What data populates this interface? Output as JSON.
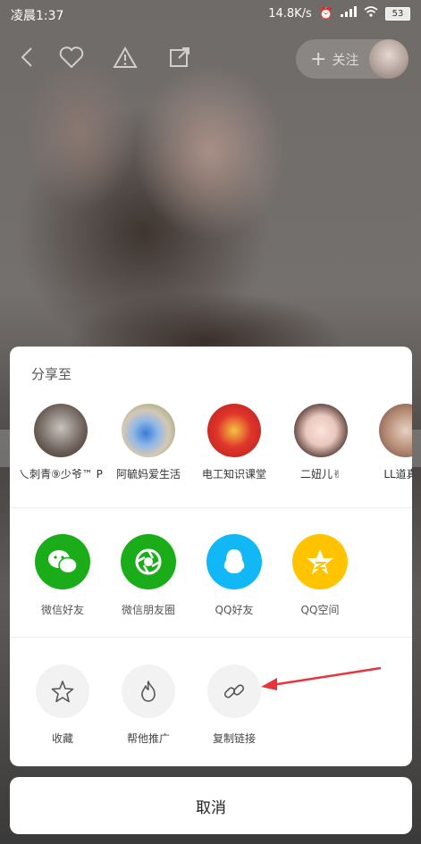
{
  "status_bar": {
    "time": "凌晨1:37",
    "speed": "14.8K/s",
    "battery": "53"
  },
  "toolbar": {
    "follow_label": "关注"
  },
  "share_sheet": {
    "title": "分享至",
    "friends": [
      {
        "name": "乀刺青⑨少爷™ P"
      },
      {
        "name": "阿毓妈爱生活"
      },
      {
        "name": "电工知识课堂"
      },
      {
        "name": "二妞儿✌"
      },
      {
        "name": "LL道真（"
      }
    ],
    "apps": [
      {
        "label": "微信好友",
        "icon": "wechat-icon",
        "color": "#1aad19"
      },
      {
        "label": "微信朋友圈",
        "icon": "moments-icon",
        "color": "#1aad19"
      },
      {
        "label": "QQ好友",
        "icon": "qq-icon",
        "color": "#12b7f5"
      },
      {
        "label": "QQ空间",
        "icon": "qzone-icon",
        "color": "#ffc300"
      }
    ],
    "actions": [
      {
        "label": "收藏",
        "icon": "star-icon"
      },
      {
        "label": "帮他推广",
        "icon": "flame-icon"
      },
      {
        "label": "复制链接",
        "icon": "link-icon"
      }
    ]
  },
  "cancel_label": "取消"
}
